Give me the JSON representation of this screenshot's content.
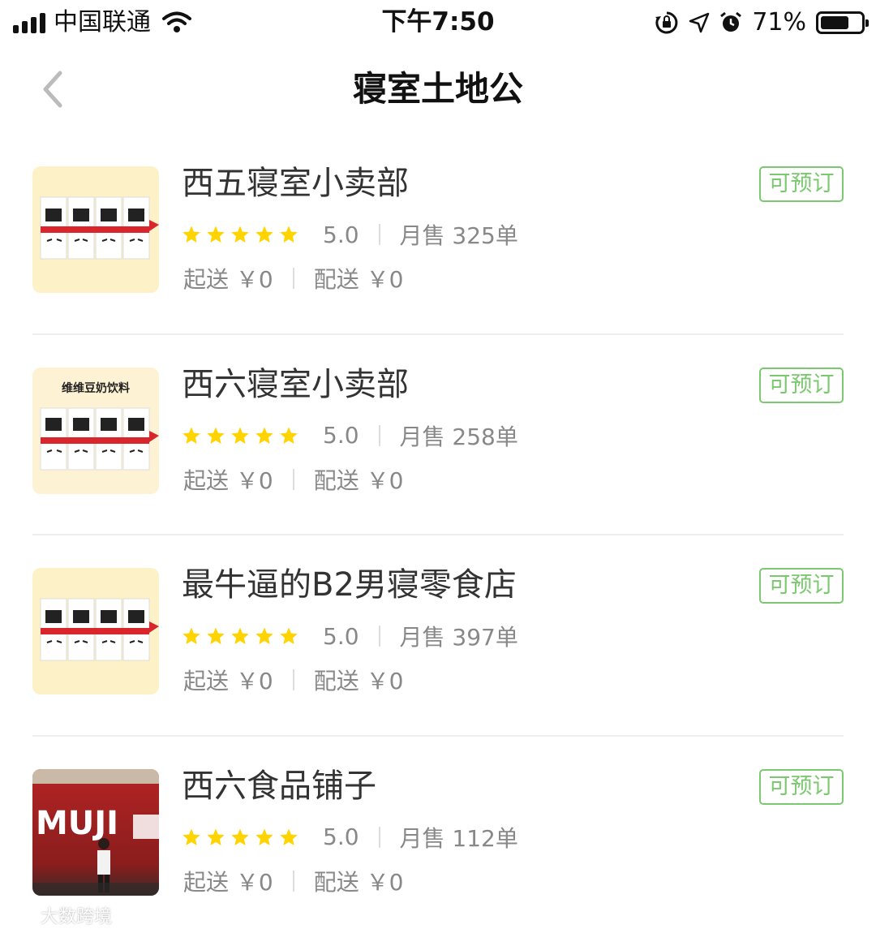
{
  "status_bar": {
    "carrier": "中国联通",
    "time": "下午7:50",
    "battery_percent": "71%",
    "battery_level": 0.71,
    "icons": [
      "signal-icon",
      "wifi-icon",
      "orientation-lock-icon",
      "location-icon",
      "alarm-icon",
      "battery-icon"
    ]
  },
  "nav": {
    "title": "寝室土地公",
    "back_icon": "chevron-left-icon"
  },
  "colors": {
    "accent_green": "#7bc96f",
    "star_yellow": "#ffd400",
    "text_dark": "#333333",
    "text_gray": "#888888"
  },
  "shops": [
    {
      "name": "西五寝室小卖部",
      "rating": "5.0",
      "rating_stars": 5,
      "sales": "月售 325单",
      "min_order": "起送 ￥0",
      "delivery_fee": "配送 ￥0",
      "book_label": "可预订",
      "thumb": "soy-milk-product-image"
    },
    {
      "name": "西六寝室小卖部",
      "rating": "5.0",
      "rating_stars": 5,
      "sales": "月售 258单",
      "min_order": "起送 ￥0",
      "delivery_fee": "配送 ￥0",
      "book_label": "可预订",
      "thumb": "soy-milk-product-image",
      "thumb_caption": "维维豆奶饮料"
    },
    {
      "name": "最牛逼的B2男寝零食店",
      "rating": "5.0",
      "rating_stars": 5,
      "sales": "月售 397单",
      "min_order": "起送 ￥0",
      "delivery_fee": "配送 ￥0",
      "book_label": "可预订",
      "thumb": "soy-milk-product-image"
    },
    {
      "name": "西六食品铺子",
      "rating": "5.0",
      "rating_stars": 5,
      "sales": "月售 112单",
      "min_order": "起送 ￥0",
      "delivery_fee": "配送 ￥0",
      "book_label": "可预订",
      "thumb": "muji-storefront-photo",
      "thumb_caption": "MUJI"
    }
  ],
  "watermark": {
    "text": "大数跨境"
  }
}
